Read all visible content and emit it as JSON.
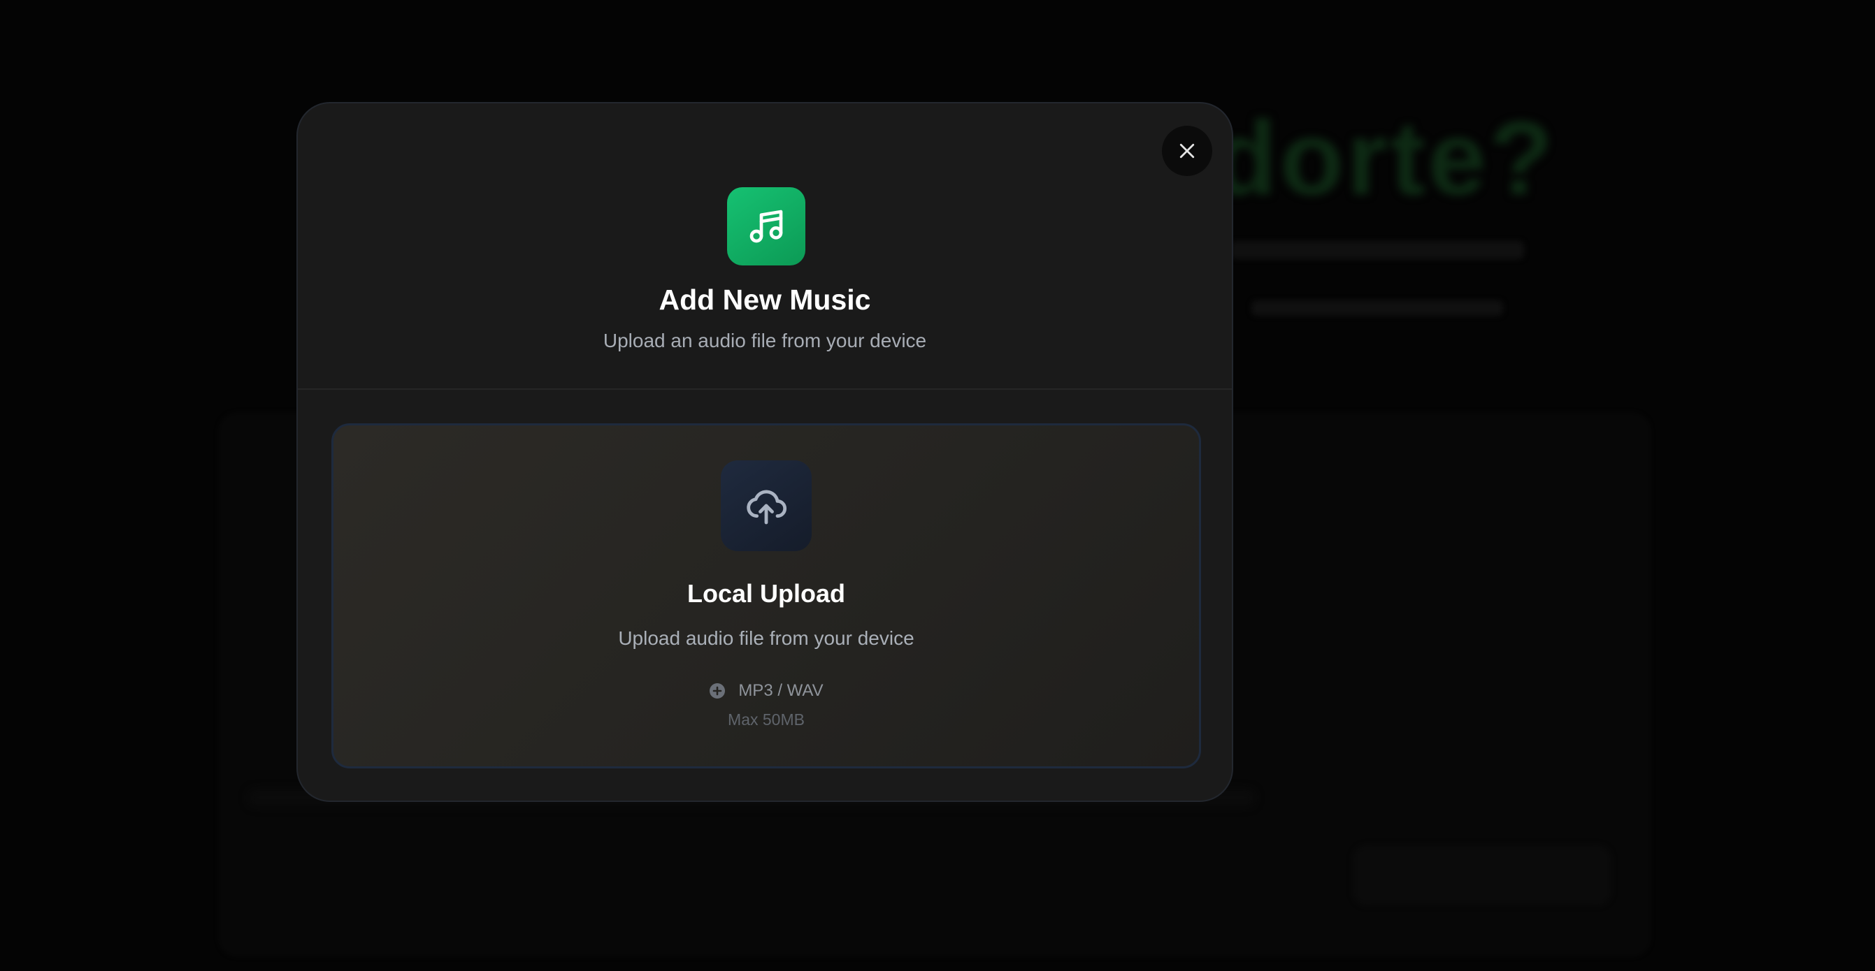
{
  "modal": {
    "title": "Add New Music",
    "subtitle": "Upload an audio file from your device",
    "close_icon": "close-icon",
    "header_icon": "music-note-icon"
  },
  "upload_option": {
    "icon": "cloud-upload-icon",
    "title": "Local Upload",
    "description": "Upload audio file from your device",
    "formats_icon": "plus-circle-icon",
    "formats": "MP3 / WAV",
    "max_size": "Max 50MB"
  },
  "colors": {
    "accent": "#10b565",
    "modal_background": "#1a1a1a",
    "card_border": "#1e2a3d"
  }
}
